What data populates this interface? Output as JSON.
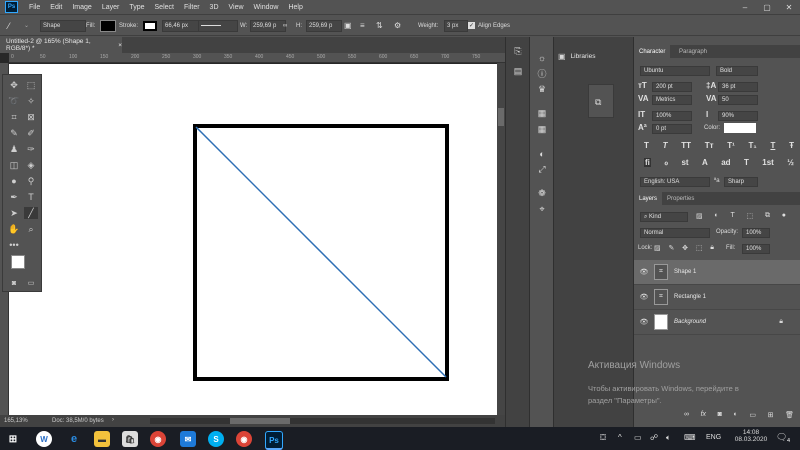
{
  "menu": {
    "logo": "Ps",
    "items": [
      "File",
      "Edit",
      "Image",
      "Layer",
      "Type",
      "Select",
      "Filter",
      "3D",
      "View",
      "Window",
      "Help"
    ]
  },
  "window_controls": {
    "minimize": "–",
    "maximize": "▢",
    "close": "✕"
  },
  "options": {
    "tool_mode": "Shape",
    "fill_label": "Fill:",
    "stroke_label": "Stroke:",
    "stroke_width": "66,46 px",
    "w_label": "W:",
    "w_value": "259,69 p",
    "link_icon": "∞",
    "h_label": "H:",
    "h_value": "259,69 p",
    "weight_label": "Weight:",
    "weight_value": "3 px",
    "align_edges_label": "Align Edges"
  },
  "document": {
    "tab_title": "Untitled-2 @ 165% (Shape 1, RGB/8*) *",
    "close_x": "×",
    "ruler_ticks": [
      "0",
      "50",
      "100",
      "150",
      "200",
      "250",
      "300",
      "350",
      "400",
      "450",
      "500",
      "550",
      "600",
      "650",
      "700",
      "750"
    ]
  },
  "status": {
    "zoom": "165,13%",
    "doc_info": "Doc: 38,5M/0 bytes"
  },
  "libraries": {
    "label": "Libraries"
  },
  "character": {
    "tabs": [
      "Character",
      "Paragraph"
    ],
    "font_family": "Ubuntu",
    "font_style": "Bold",
    "font_size": "200 pt",
    "leading": "36 pt",
    "kerning": "Metrics",
    "tracking": "50",
    "vertical_scale": "100%",
    "horizontal_scale": "90%",
    "baseline_shift": "0 pt",
    "color_label": "Color:",
    "language": "English: USA",
    "antialias": "Sharp",
    "style_glyphs_row1": [
      "T",
      "T",
      "TT",
      "Tт",
      "T¹",
      "T₁",
      "T",
      "Ŧ"
    ],
    "style_glyphs_row2": [
      "fi",
      "ℴ",
      "st",
      "A",
      "ad",
      "T",
      "1st",
      "½"
    ]
  },
  "layers": {
    "tabs": [
      "Layers",
      "Properties"
    ],
    "filter_kind": "Kind",
    "blend_mode": "Normal",
    "opacity_label": "Opacity:",
    "opacity_value": "100%",
    "lock_label": "Lock:",
    "fill_label": "Fill:",
    "fill_value": "100%",
    "items": [
      {
        "name": "Shape 1",
        "selected": true
      },
      {
        "name": "Rectangle 1",
        "selected": false
      },
      {
        "name": "Background",
        "selected": false
      }
    ],
    "bottom_icons": [
      "link-icon",
      "fx",
      "mask-icon",
      "adjustment-icon",
      "folder-icon",
      "new-layer-icon",
      "trash-icon"
    ]
  },
  "watermark": {
    "title": "Активация Windows",
    "line1": "Чтобы активировать Windows, перейдите в",
    "line2": "раздел \"Параметры\"."
  },
  "taskbar": {
    "language": "ENG",
    "time": "14:08",
    "date": "08.03.2020",
    "notification_count": "4"
  },
  "colors": {
    "accent_blue": "#2e6fb5",
    "ps_dark": "#001e36",
    "ps_blue": "#31a8ff"
  }
}
